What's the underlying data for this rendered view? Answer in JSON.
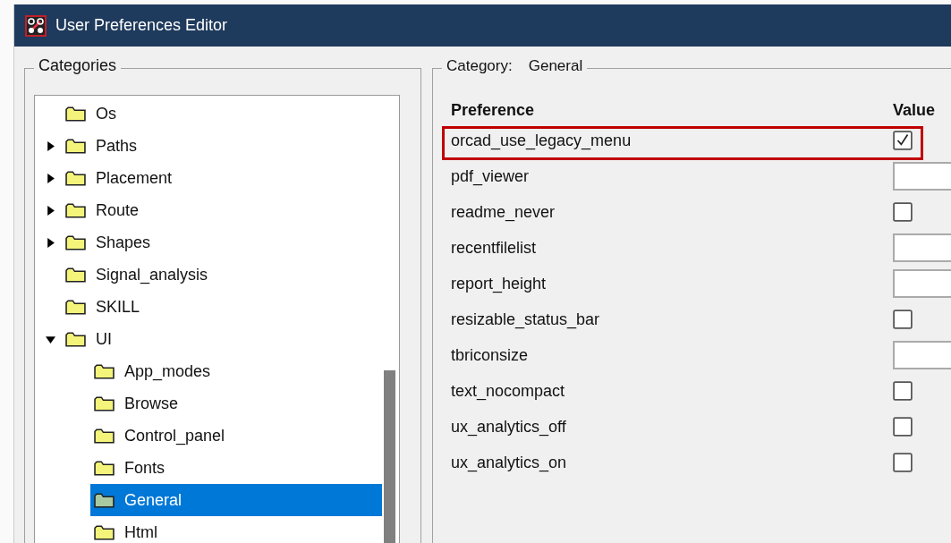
{
  "window": {
    "title": "User Preferences Editor"
  },
  "categories": {
    "title": "Categories",
    "items": [
      {
        "label": "Os",
        "selected": false
      },
      {
        "label": "Paths",
        "selected": false,
        "expanded": false
      },
      {
        "label": "Placement",
        "selected": false,
        "expanded": false
      },
      {
        "label": "Route",
        "selected": false,
        "expanded": false
      },
      {
        "label": "Shapes",
        "selected": false,
        "expanded": false
      },
      {
        "label": "Signal_analysis",
        "selected": false
      },
      {
        "label": "SKILL",
        "selected": false
      },
      {
        "label": "UI",
        "selected": false,
        "expanded": true,
        "children": [
          {
            "label": "App_modes",
            "selected": false
          },
          {
            "label": "Browse",
            "selected": false
          },
          {
            "label": "Control_panel",
            "selected": false
          },
          {
            "label": "Fonts",
            "selected": false
          },
          {
            "label": "General",
            "selected": true
          },
          {
            "label": "Html",
            "selected": false
          }
        ]
      }
    ]
  },
  "category_panel": {
    "label": "Category:",
    "value": "General",
    "columns": [
      "Preference",
      "Value"
    ],
    "rows": [
      {
        "name": "orcad_use_legacy_menu",
        "kind": "checkbox",
        "checked": true,
        "highlighted": true
      },
      {
        "name": "pdf_viewer",
        "kind": "text",
        "highlighted": false
      },
      {
        "name": "readme_never",
        "kind": "checkbox",
        "checked": false,
        "highlighted": false
      },
      {
        "name": "recentfilelist",
        "kind": "text",
        "highlighted": false
      },
      {
        "name": "report_height",
        "kind": "text",
        "highlighted": false
      },
      {
        "name": "resizable_status_bar",
        "kind": "checkbox",
        "checked": false,
        "highlighted": false
      },
      {
        "name": "tbriconsize",
        "kind": "text",
        "highlighted": false
      },
      {
        "name": "text_nocompact",
        "kind": "checkbox",
        "checked": false,
        "highlighted": false
      },
      {
        "name": "ux_analytics_off",
        "kind": "checkbox",
        "checked": false,
        "highlighted": false
      },
      {
        "name": "ux_analytics_on",
        "kind": "checkbox",
        "checked": false,
        "highlighted": false
      }
    ]
  }
}
